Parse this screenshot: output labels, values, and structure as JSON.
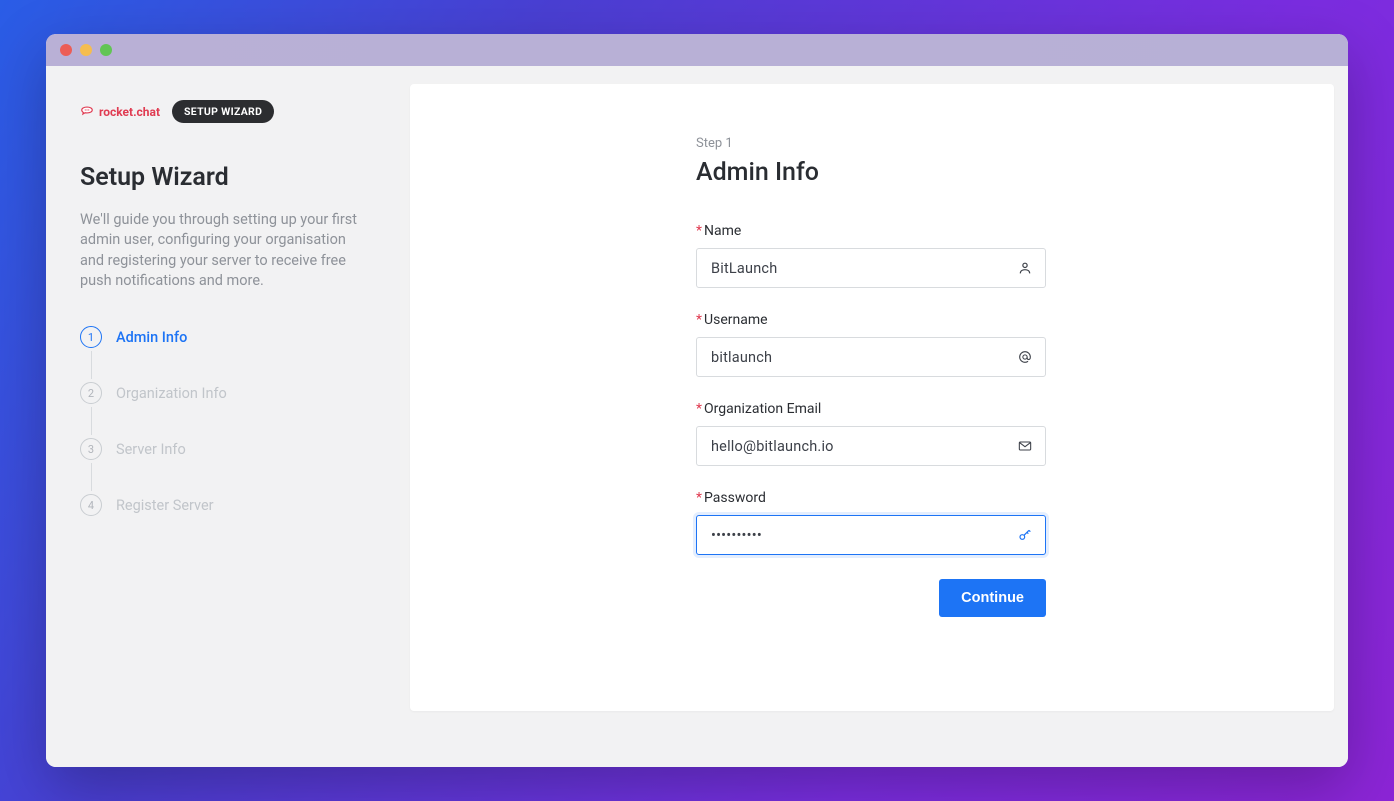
{
  "brand": {
    "name": "rocket.chat"
  },
  "pill": "SETUP WIZARD",
  "sidebar": {
    "title": "Setup Wizard",
    "description": "We'll guide you through setting up your first admin user, configuring your organisation and registering your server to receive free push notifications and more.",
    "steps": [
      {
        "num": "1",
        "label": "Admin Info",
        "active": true
      },
      {
        "num": "2",
        "label": "Organization Info",
        "active": false
      },
      {
        "num": "3",
        "label": "Server Info",
        "active": false
      },
      {
        "num": "4",
        "label": "Register Server",
        "active": false
      }
    ]
  },
  "form": {
    "step_label": "Step 1",
    "title": "Admin Info",
    "fields": {
      "name": {
        "label": "Name",
        "value": "BitLaunch"
      },
      "username": {
        "label": "Username",
        "value": "bitlaunch"
      },
      "org_email": {
        "label": "Organization Email",
        "value": "hello@bitlaunch.io"
      },
      "password": {
        "label": "Password",
        "value": "••••••••••"
      }
    },
    "continue": "Continue"
  }
}
